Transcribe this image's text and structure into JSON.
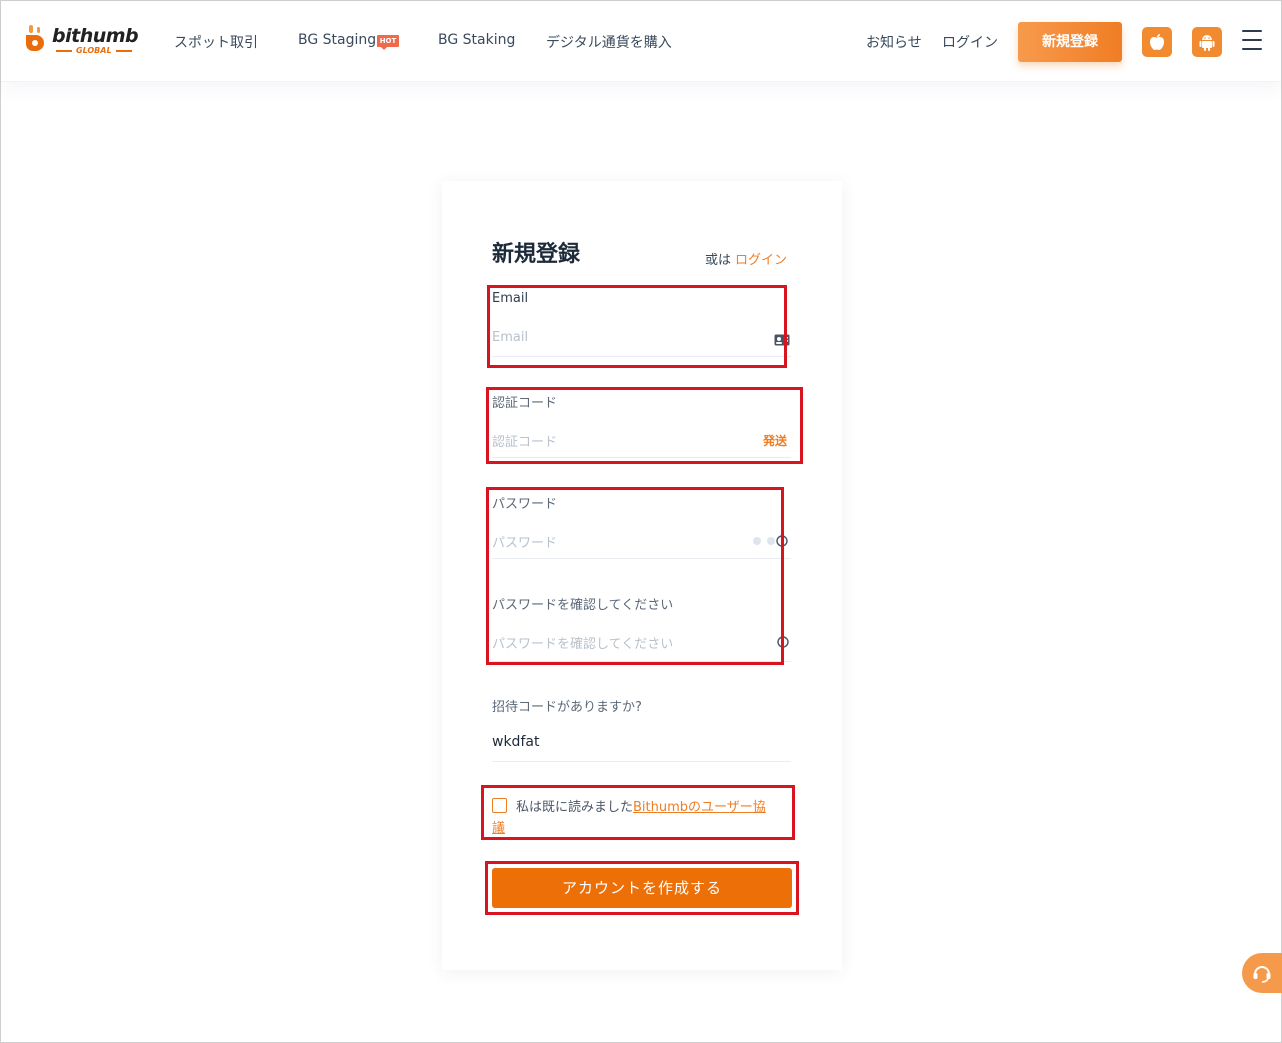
{
  "header": {
    "logo_word": "bithumb",
    "logo_sub": "GLOBAL",
    "nav": [
      {
        "label": "スポット取引"
      },
      {
        "label": "BG Staging",
        "badge": "HOT"
      },
      {
        "label": "BG Staking"
      },
      {
        "label": "デジタル通貨を購入"
      }
    ],
    "notice": "お知らせ",
    "login": "ログイン",
    "register": "新規登録",
    "icons": [
      "apple-icon",
      "android-icon",
      "menu-icon"
    ]
  },
  "form": {
    "title": "新規登録",
    "or_text": "或は",
    "login_link": "ログイン",
    "email_label": "Email",
    "email_placeholder": "Email",
    "code_label": "認証コード",
    "code_placeholder": "認証コード",
    "send_label": "発送",
    "password_label": "パスワード",
    "password_placeholder": "パスワード",
    "confirm_label": "パスワードを確認してください",
    "confirm_placeholder": "パスワードを確認してください",
    "invite_label": "招待コードがありますか?",
    "invite_value": "wkdfat",
    "agree_text": "私は既に読みました",
    "agree_link_1": "Bithumbのユーザー協",
    "agree_link_2": "議",
    "agree_checked": false,
    "submit_label": "アカウントを作成する"
  },
  "colors": {
    "accent": "#ef7d24",
    "submit": "#ec6f07",
    "highlight": "#d7141f"
  }
}
